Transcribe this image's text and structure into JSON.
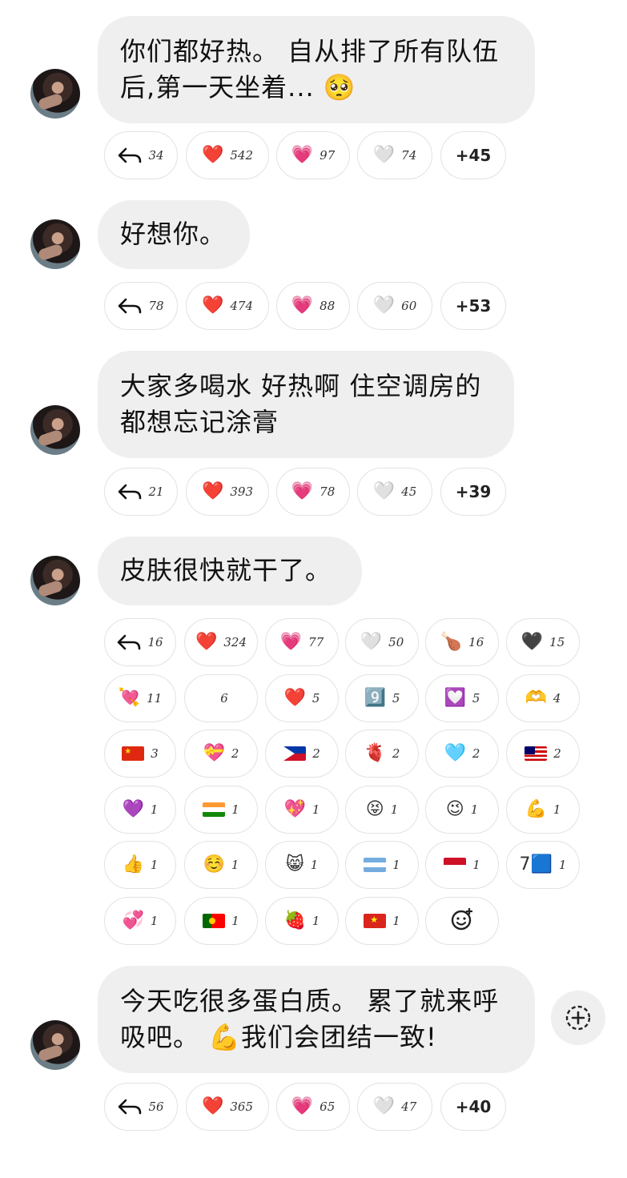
{
  "messages": [
    {
      "text": "你们都好热。 自从排了所有队伍后,第一天坐着... 🥺",
      "line1": "你们都好热。 自从排了所有队伍",
      "line2": "后,第一天坐着... 🥺",
      "reactions": [
        {
          "kind": "reply",
          "count": "34"
        },
        {
          "emoji": "❤️",
          "count": "542"
        },
        {
          "emoji": "💗",
          "count": "97"
        },
        {
          "emoji": "🤍",
          "count": "74"
        },
        {
          "more": "+45"
        }
      ]
    },
    {
      "text": "好想你。",
      "line1": "好想你。",
      "reactions": [
        {
          "kind": "reply",
          "count": "78"
        },
        {
          "emoji": "❤️",
          "count": "474"
        },
        {
          "emoji": "💗",
          "count": "88"
        },
        {
          "emoji": "🤍",
          "count": "60"
        },
        {
          "more": "+53"
        }
      ]
    },
    {
      "text": "大家多喝水 好热啊 住空调房的都想忘记涂膏",
      "line1": "大家多喝水 好热啊 住空调房的",
      "line2": "都想忘记涂膏",
      "reactions": [
        {
          "kind": "reply",
          "count": "21"
        },
        {
          "emoji": "❤️",
          "count": "393"
        },
        {
          "emoji": "💗",
          "count": "78"
        },
        {
          "emoji": "🤍",
          "count": "45"
        },
        {
          "more": "+39"
        }
      ]
    },
    {
      "text": "皮肤很快就干了。",
      "line1": "皮肤很快就干了。",
      "reactions": [
        {
          "kind": "reply",
          "count": "16"
        },
        {
          "emoji": "❤️",
          "count": "324"
        },
        {
          "emoji": "💗",
          "count": "77"
        },
        {
          "emoji": "🤍",
          "count": "50"
        },
        {
          "emoji": "🍗",
          "count": "16"
        },
        {
          "emoji": "🖤",
          "count": "15"
        },
        {
          "emoji": "💘",
          "count": "11"
        },
        {
          "emoji": "",
          "count": "6"
        },
        {
          "emoji": "❤️",
          "count": "5"
        },
        {
          "emoji": "9️⃣",
          "count": "5"
        },
        {
          "emoji": "💟",
          "count": "5"
        },
        {
          "emoji": "🫶",
          "count": "4"
        },
        {
          "flag": "cn",
          "count": "3"
        },
        {
          "emoji": "💝",
          "count": "2"
        },
        {
          "flag": "ph",
          "count": "2"
        },
        {
          "emoji": "🫀",
          "count": "2"
        },
        {
          "emoji": "🩵",
          "count": "2"
        },
        {
          "flag": "my",
          "count": "2"
        },
        {
          "emoji": "💜",
          "count": "1"
        },
        {
          "flag": "in",
          "count": "1"
        },
        {
          "emoji": "💖",
          "count": "1"
        },
        {
          "emoji": "😝",
          "count": "1"
        },
        {
          "emoji": "😉",
          "count": "1"
        },
        {
          "emoji": "💪",
          "count": "1"
        },
        {
          "emoji": "👍",
          "count": "1"
        },
        {
          "emoji": "☺️",
          "count": "1"
        },
        {
          "emoji": "😸",
          "count": "1"
        },
        {
          "flag": "ar",
          "count": "1"
        },
        {
          "flag": "id",
          "count": "1"
        },
        {
          "emoji": "7🟦",
          "count": "1"
        },
        {
          "emoji": "💞",
          "count": "1"
        },
        {
          "flag": "pt",
          "count": "1"
        },
        {
          "emoji": "🍓",
          "count": "1"
        },
        {
          "flag": "vn",
          "count": "1"
        },
        {
          "kind": "add"
        }
      ]
    },
    {
      "text": "今天吃很多蛋白质。 累了就来呼吸吧。 💪我们会团结一致!",
      "line1": "今天吃很多蛋白质。 累了就来呼",
      "line2": "吸吧。 💪我们会团结一致!",
      "reactions": [
        {
          "kind": "reply",
          "count": "56"
        },
        {
          "emoji": "❤️",
          "count": "365"
        },
        {
          "emoji": "💗",
          "count": "65"
        },
        {
          "emoji": "🤍",
          "count": "47"
        },
        {
          "more": "+40"
        }
      ]
    }
  ],
  "icons": {
    "reply": "reply-arrow-icon",
    "add_reaction": "add-reaction-icon",
    "thread_action": "thread-add-icon"
  },
  "colors": {
    "bubble_bg": "#efefef",
    "chip_border": "#e2e2e2",
    "text": "#111111"
  }
}
